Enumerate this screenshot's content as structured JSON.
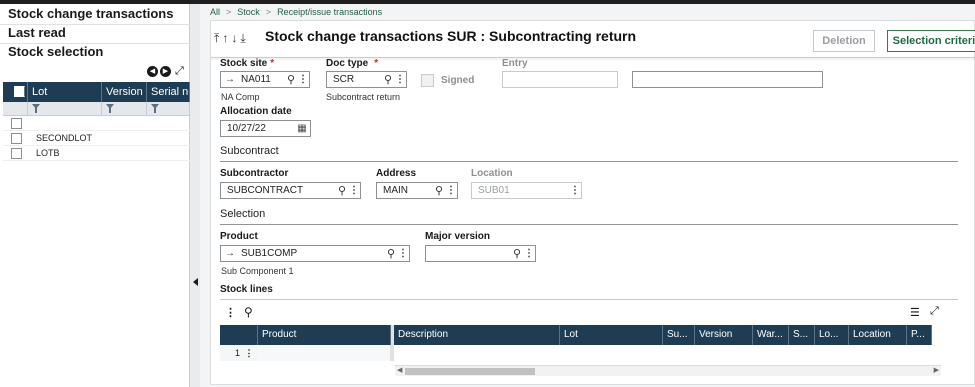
{
  "left_panel": {
    "stock_change_transactions": "Stock change transactions",
    "last_read": "Last read",
    "stock_selection": "Stock selection",
    "grid": {
      "columns": [
        "Lot",
        "Version",
        "Serial nu"
      ],
      "rows": [
        "",
        "SECONDLOT",
        "LOTB"
      ]
    }
  },
  "breadcrumb": [
    "All",
    "Stock",
    "Receipt/issue transactions"
  ],
  "header": {
    "title": "Stock change transactions SUR : Subcontracting return",
    "deletion_label": "Deletion",
    "selection_criteria_label": "Selection criteria"
  },
  "form": {
    "stock_site": {
      "label": "Stock site",
      "value": "NA011",
      "sub": "NA Comp"
    },
    "doc_type": {
      "label": "Doc type",
      "value": "SCR",
      "sub": "Subcontract return"
    },
    "signed": {
      "label": "Signed"
    },
    "entry": {
      "label": "Entry",
      "value1": "",
      "value2": ""
    },
    "allocation_date": {
      "label": "Allocation date",
      "value": "10/27/22"
    },
    "subcontract_section": "Subcontract",
    "subcontractor": {
      "label": "Subcontractor",
      "value": "SUBCONTRACT"
    },
    "address": {
      "label": "Address",
      "value": "MAIN"
    },
    "location": {
      "label": "Location",
      "value": "SUB01"
    },
    "selection_section": "Selection",
    "product": {
      "label": "Product",
      "value": "SUB1COMP",
      "sub": "Sub Component 1"
    },
    "major_version": {
      "label": "Major version",
      "value": ""
    }
  },
  "stock_lines": {
    "title": "Stock lines",
    "columns": [
      "Product",
      "Description",
      "Lot",
      "Su...",
      "Version",
      "War...",
      "S...",
      "Lo...",
      "Location",
      "P..."
    ],
    "row_number": "1"
  },
  "colors": {
    "grid_header": "#1e3d55",
    "accent_green": "#2e7d4f",
    "required": "#c42b2b"
  }
}
